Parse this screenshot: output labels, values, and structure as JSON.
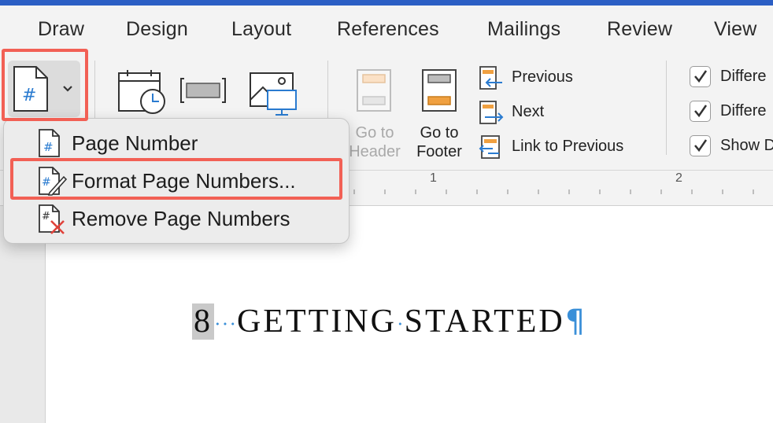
{
  "tabs": [
    "Draw",
    "Design",
    "Layout",
    "References",
    "Mailings",
    "Review",
    "View"
  ],
  "ribbon": {
    "page_number_icon_glyph": "#",
    "go_to_header": {
      "line1": "Go to",
      "line2": "Header"
    },
    "go_to_footer": {
      "line1": "Go to",
      "line2": "Footer"
    },
    "previous": "Previous",
    "next": "Next",
    "link_to_previous": "Link to Previous",
    "options": [
      "Differe",
      "Differe",
      "Show D"
    ]
  },
  "ruler": {
    "marks": [
      "1",
      "2"
    ]
  },
  "menu": {
    "items": [
      {
        "label": "Page Number",
        "icon": "page-number-icon"
      },
      {
        "label": "Format Page Numbers...",
        "icon": "format-page-numbers-icon"
      },
      {
        "label": "Remove Page Numbers",
        "icon": "remove-page-numbers-icon"
      }
    ]
  },
  "document": {
    "page_number": "8",
    "heading_word1": "GETTING",
    "heading_word2": "STARTED",
    "pilcrow": "¶"
  },
  "colors": {
    "highlight": "#f26055",
    "accent_blue": "#3a8fd8",
    "orange": "#f0a040",
    "title_bar": "#2b5ec4"
  }
}
